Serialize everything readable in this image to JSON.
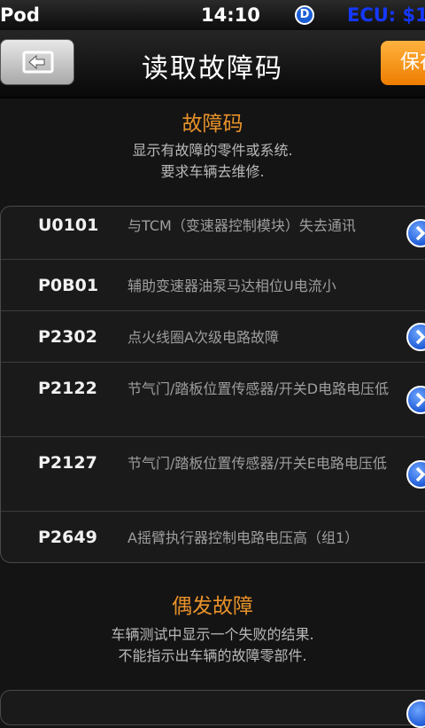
{
  "status_bar": {
    "carrier": "Pod",
    "time": "14:10",
    "badge": "D",
    "ecu_text": "ECU: $1"
  },
  "nav": {
    "title": "读取故障码",
    "save_label": "保存",
    "back_icon": "back-arrow-icon"
  },
  "fault_section": {
    "title": "故障码",
    "desc_line1": "显示有故障的零件或系统.",
    "desc_line2": "要求车辆去维修."
  },
  "fault_codes": [
    {
      "code": "U0101",
      "desc": "与TCM（变速器控制模块）失去通讯",
      "has_detail": true
    },
    {
      "code": "P0B01",
      "desc": "辅助变速器油泵马达相位U电流小",
      "has_detail": false
    },
    {
      "code": "P2302",
      "desc": "点火线圈A次级电路故障",
      "has_detail": true
    },
    {
      "code": "P2122",
      "desc": "节气门/踏板位置传感器/开关D电路电压低",
      "has_detail": true
    },
    {
      "code": "P2127",
      "desc": "节气门/踏板位置传感器/开关E电路电压低",
      "has_detail": true
    },
    {
      "code": "P2649",
      "desc": "A摇臂执行器控制电路电压高（组1）",
      "has_detail": false
    }
  ],
  "intermittent_section": {
    "title": "偶发故障",
    "desc_line1": "车辆测试中显示一个失败的结果.",
    "desc_line2": "不能指示出车辆的故障零部件."
  },
  "colors": {
    "accent_orange": "#e8922a",
    "save_orange": "#f39200",
    "detail_blue": "#1e5bd6",
    "ecu_blue": "#1538ff"
  }
}
